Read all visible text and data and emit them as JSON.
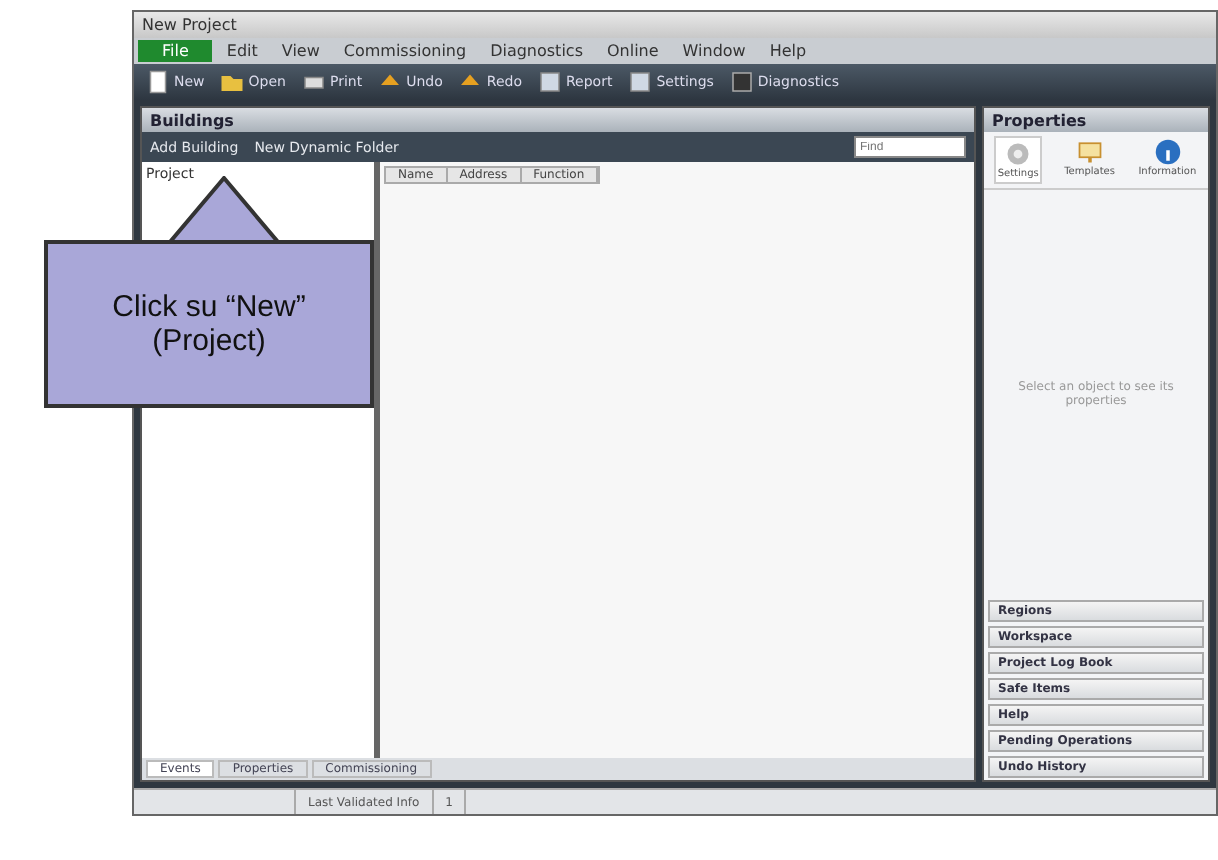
{
  "window": {
    "title": "New Project"
  },
  "menu": [
    {
      "label": "File",
      "selected": true
    },
    {
      "label": "Edit",
      "selected": false
    },
    {
      "label": "View",
      "selected": false
    },
    {
      "label": "Commissioning",
      "selected": false
    },
    {
      "label": "Diagnostics",
      "selected": false
    },
    {
      "label": "Online",
      "selected": false
    },
    {
      "label": "Window",
      "selected": false
    },
    {
      "label": "Help",
      "selected": false
    }
  ],
  "toolbar": [
    {
      "label": "New"
    },
    {
      "label": "Open"
    },
    {
      "label": "Print"
    },
    {
      "label": "Undo"
    },
    {
      "label": "Redo"
    },
    {
      "label": "Report"
    },
    {
      "label": "Settings"
    },
    {
      "label": "Diagnostics"
    }
  ],
  "buildings_pane": {
    "title": "Buildings",
    "actions": [
      "Add Building",
      "New Dynamic Folder"
    ],
    "search": {
      "placeholder": "Find"
    },
    "columns": [
      "Name",
      "Address",
      "Function"
    ],
    "tree": [
      {
        "label": "Project"
      }
    ],
    "bottom_tabs": [
      {
        "label": "Events",
        "selected": true
      },
      {
        "label": "Properties",
        "selected": false
      },
      {
        "label": "Commissioning",
        "selected": false
      }
    ]
  },
  "properties_pane": {
    "title": "Properties",
    "tabs": [
      {
        "label": "Settings",
        "selected": true
      },
      {
        "label": "Templates",
        "selected": false
      },
      {
        "label": "Information",
        "selected": false
      }
    ],
    "message": "Select an object to see its properties",
    "sections": [
      "Regions",
      "Workspace",
      "Project Log Book",
      "Safe Items",
      "Help",
      "Pending Operations",
      "Undo History"
    ]
  },
  "status_bar": [
    "Last Validated Info",
    "1"
  ],
  "callout": {
    "text": "Click su “New”\n(Project)"
  }
}
